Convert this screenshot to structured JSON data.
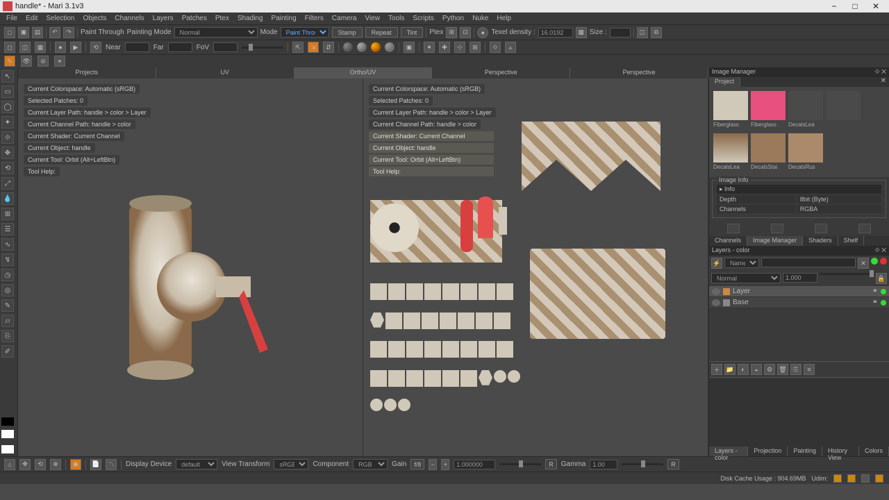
{
  "window": {
    "title": "handle* - Mari 3.1v3"
  },
  "menu": [
    "File",
    "Edit",
    "Selection",
    "Objects",
    "Channels",
    "Layers",
    "Patches",
    "Ptex",
    "Shading",
    "Painting",
    "Filters",
    "Camera",
    "View",
    "Tools",
    "Scripts",
    "Python",
    "Nuke",
    "Help"
  ],
  "toolbar1": {
    "paint_through": "Paint Through",
    "painting_mode_label": "Painting Mode",
    "painting_mode_value": "Normal",
    "mode_label": "Mode",
    "mode_value": "Paint Through",
    "stamp": "Stamp",
    "repeat": "Repeat",
    "tint": "Tint",
    "ptex": "Ptex",
    "texel_density": "Texel density :",
    "texel_value": "16.0192",
    "size": "Size :"
  },
  "toolbar2": {
    "near": "Near",
    "far": "Far",
    "fov": "FoV"
  },
  "viewport_tabs": [
    "Projects",
    "UV",
    "Ortho/UV",
    "Perspective",
    "Perspective"
  ],
  "vp1_info": [
    "Current Colorspace: Automatic (sRGB)",
    "Selected Patches: 0",
    "Current Layer Path: handle > color > Layer",
    "Current Channel Path: handle > color",
    "Current Shader: Current Channel",
    "Current Object: handle",
    "Current Tool: Orbit (Alt+LeftBtn)",
    "Tool Help:"
  ],
  "vp2_info_top": [
    "Current Colorspace: Automatic (sRGB)",
    "Selected Patches: 0",
    "Current Layer Path: handle > color > Layer",
    "Current Channel Path: handle > color"
  ],
  "vp2_info_box": [
    "Current Shader: Current Channel",
    "Current Object: handle",
    "Current Tool: Orbit (Alt+LeftBtn)",
    "Tool Help:"
  ],
  "right": {
    "image_manager": "Image Manager",
    "project_tab": "Project",
    "thumbs": [
      "Fiberglass",
      "Fiberglass",
      "DecalsLea",
      "",
      "DecalsLea",
      "DecalsStai",
      "DecalsRus",
      ""
    ],
    "image_info": "Image Info",
    "info_label": "Info",
    "depth": "Depth",
    "depth_val": "8bit (Byte)",
    "channels": "Channels",
    "channels_val": "RGBA",
    "tabs2": [
      "Channels",
      "Image Manager",
      "Shaders",
      "Shelf"
    ],
    "layers_title": "Layers - color",
    "name_label": "Name",
    "blend_mode": "Normal",
    "opacity": "1.000",
    "layer1": "Layer",
    "layer2": "Base",
    "bottom_tabs": [
      "Layers - color",
      "Projection",
      "Painting",
      "History View",
      "Colors"
    ]
  },
  "bottombar": {
    "display_device": "Display Device",
    "display_device_val": "default",
    "view_transform": "View Transform",
    "view_transform_val": "sRGB",
    "component": "Component",
    "component_val": "RGB",
    "gain": "Gain",
    "gain_fstop": "f/8",
    "gain_val": "1.000000",
    "r": "R",
    "gamma": "Gamma",
    "gamma_val": "1.00",
    "r2": "R"
  },
  "status": {
    "disk_cache": "Disk Cache Usage : 904.69MB",
    "udim": "Udim:"
  }
}
